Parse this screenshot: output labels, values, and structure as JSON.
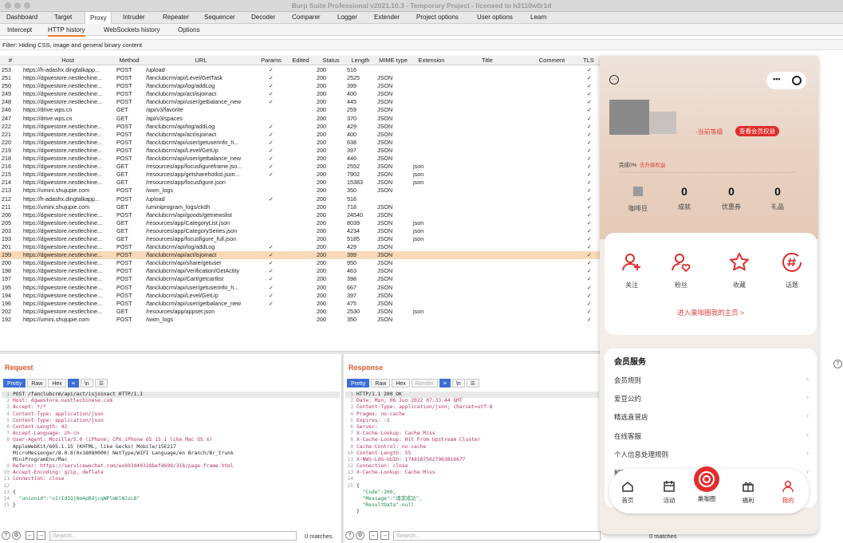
{
  "window": {
    "title": "Burp Suite Professional v2021.10.3 - Temporary Project - licensed to h3110w0r1d"
  },
  "menu": [
    "Dashboard",
    "Target",
    "Proxy",
    "Intruder",
    "Repeater",
    "Sequencer",
    "Decoder",
    "Comparer",
    "Logger",
    "Extender",
    "Project options",
    "User options",
    "Learn"
  ],
  "subtabs": [
    "Intercept",
    "HTTP history",
    "WebSockets history",
    "Options"
  ],
  "filter": "Filter: Hiding CSS, image and general binary content",
  "columns": [
    "#",
    "Host",
    "Method",
    "URL",
    "Params",
    "Edited",
    "Status",
    "Length",
    "MIME type",
    "Extension",
    "Title",
    "Comment",
    "TLS"
  ],
  "rows": [
    {
      "n": "253",
      "host": "https://h-adashx.dingtalkapp...",
      "m": "POST",
      "url": "/upload",
      "p": "✓",
      "st": "200",
      "len": "516",
      "mime": "",
      "ext": "",
      "tls": "✓"
    },
    {
      "n": "251",
      "host": "https://dgwestore.nestlechine...",
      "m": "POST",
      "url": "/fanclubcrm/api/Level/GetTask",
      "p": "✓",
      "st": "200",
      "len": "2525",
      "mime": "JSON",
      "ext": "",
      "tls": "✓"
    },
    {
      "n": "250",
      "host": "https://dgwestore.nestlechine...",
      "m": "POST",
      "url": "/fanclubcrm/api/log/addLog",
      "p": "✓",
      "st": "200",
      "len": "399",
      "mime": "JSON",
      "ext": "",
      "tls": "✓"
    },
    {
      "n": "249",
      "host": "https://dgwestore.nestlechine...",
      "m": "POST",
      "url": "/fanclubcrm/api/act/isjoinact",
      "p": "✓",
      "st": "200",
      "len": "400",
      "mime": "JSON",
      "ext": "",
      "tls": "✓"
    },
    {
      "n": "248",
      "host": "https://dgwestore.nestlechine...",
      "m": "POST",
      "url": "/fanclubcrm/api/user/getbalance_new",
      "p": "✓",
      "st": "200",
      "len": "445",
      "mime": "JSON",
      "ext": "",
      "tls": "✓"
    },
    {
      "n": "246",
      "host": "https://drive.wps.cn",
      "m": "GET",
      "url": "/api/v3/favorite",
      "p": "",
      "st": "200",
      "len": "259",
      "mime": "JSON",
      "ext": "",
      "tls": "✓"
    },
    {
      "n": "247",
      "host": "https://drive.wps.cn",
      "m": "GET",
      "url": "/api/v3/spaces",
      "p": "",
      "st": "200",
      "len": "370",
      "mime": "JSON",
      "ext": "",
      "tls": "✓"
    },
    {
      "n": "222",
      "host": "https://dgwestore.nestlechine...",
      "m": "POST",
      "url": "/fanclubcrm/api/log/addLog",
      "p": "✓",
      "st": "200",
      "len": "429",
      "mime": "JSON",
      "ext": "",
      "tls": "✓"
    },
    {
      "n": "221",
      "host": "https://dgwestore.nestlechine...",
      "m": "POST",
      "url": "/fanclubcrm/api/act/isjoinact",
      "p": "✓",
      "st": "200",
      "len": "400",
      "mime": "JSON",
      "ext": "",
      "tls": "✓"
    },
    {
      "n": "220",
      "host": "https://dgwestore.nestlechine...",
      "m": "POST",
      "url": "/fanclubcrm/api/user/getuserinfo_h...",
      "p": "✓",
      "st": "200",
      "len": "638",
      "mime": "JSON",
      "ext": "",
      "tls": "✓"
    },
    {
      "n": "219",
      "host": "https://dgwestore.nestlechine...",
      "m": "POST",
      "url": "/fanclubcrm/api/Level/GetUp",
      "p": "✓",
      "st": "200",
      "len": "397",
      "mime": "JSON",
      "ext": "",
      "tls": "✓"
    },
    {
      "n": "218",
      "host": "https://dgwestore.nestlechine...",
      "m": "POST",
      "url": "/fanclubcrm/api/user/getbalance_new",
      "p": "✓",
      "st": "200",
      "len": "446",
      "mime": "JSON",
      "ext": "",
      "tls": "✓"
    },
    {
      "n": "216",
      "host": "https://dgwestore.nestlechine...",
      "m": "GET",
      "url": "/resources/app/focusfigureframe.jso...",
      "p": "✓",
      "st": "200",
      "len": "2552",
      "mime": "JSON",
      "ext": "json",
      "tls": "✓"
    },
    {
      "n": "215",
      "host": "https://dgwestore.nestlechine...",
      "m": "GET",
      "url": "/resources/app/getsharehotlist.json...",
      "p": "✓",
      "st": "200",
      "len": "7902",
      "mime": "JSON",
      "ext": "json",
      "tls": "✓"
    },
    {
      "n": "214",
      "host": "https://dgwestore.nestlechine...",
      "m": "GET",
      "url": "/resources/app/focusfigure.json",
      "p": "",
      "st": "200",
      "len": "15383",
      "mime": "JSON",
      "ext": "json",
      "tls": "✓"
    },
    {
      "n": "213",
      "host": "https://umini.shujupie.com",
      "m": "POST",
      "url": "/wxm_logs",
      "p": "",
      "st": "200",
      "len": "350",
      "mime": "JSON",
      "ext": "",
      "tls": "✓"
    },
    {
      "n": "212",
      "host": "https://h-adashx.dingtalkapp...",
      "m": "POST",
      "url": "/upload",
      "p": "✓",
      "st": "200",
      "len": "516",
      "mime": "",
      "ext": "",
      "tls": "✓"
    },
    {
      "n": "211",
      "host": "https://umini.shujupie.com",
      "m": "GET",
      "url": "/uminiprogram_logs/ckdh",
      "p": "",
      "st": "200",
      "len": "718",
      "mime": "JSON",
      "ext": "",
      "tls": "✓"
    },
    {
      "n": "206",
      "host": "https://dgwestore.nestlechine...",
      "m": "POST",
      "url": "/fanclubcrm/api/goods/getnewslist",
      "p": "",
      "st": "200",
      "len": "24540",
      "mime": "JSON",
      "ext": "",
      "tls": "✓"
    },
    {
      "n": "205",
      "host": "https://dgwestore.nestlechine...",
      "m": "GET",
      "url": "/resources/app/CategoryList.json",
      "p": "",
      "st": "200",
      "len": "8039",
      "mime": "JSON",
      "ext": "json",
      "tls": "✓"
    },
    {
      "n": "203",
      "host": "https://dgwestore.nestlechine...",
      "m": "GET",
      "url": "/resources/app/CategorySeries.json",
      "p": "",
      "st": "200",
      "len": "4234",
      "mime": "JSON",
      "ext": "json",
      "tls": "✓"
    },
    {
      "n": "193",
      "host": "https://dgwestore.nestlechine...",
      "m": "GET",
      "url": "/resources/app/focusfigure_full.json",
      "p": "",
      "st": "200",
      "len": "5185",
      "mime": "JSON",
      "ext": "json",
      "tls": "✓"
    },
    {
      "n": "201",
      "host": "https://dgwestore.nestlechine...",
      "m": "POST",
      "url": "/fanclubcrm/api/log/addLog",
      "p": "✓",
      "st": "200",
      "len": "429",
      "mime": "JSON",
      "ext": "",
      "tls": "✓"
    },
    {
      "n": "199",
      "host": "https://dgwestore.nestlechine...",
      "m": "POST",
      "url": "/fanclubcrm/api/act/isjoinact",
      "p": "✓",
      "st": "200",
      "len": "399",
      "mime": "JSON",
      "ext": "",
      "tls": "✓",
      "sel": true
    },
    {
      "n": "200",
      "host": "https://dgwestore.nestlechine...",
      "m": "POST",
      "url": "/fanclubcrm/api/share/getuser",
      "p": "✓",
      "st": "200",
      "len": "950",
      "mime": "JSON",
      "ext": "",
      "tls": "✓"
    },
    {
      "n": "198",
      "host": "https://dgwestore.nestlechine...",
      "m": "POST",
      "url": "/fanclubcrm/api/Verification/GetActity",
      "p": "✓",
      "st": "200",
      "len": "463",
      "mime": "JSON",
      "ext": "",
      "tls": "✓"
    },
    {
      "n": "197",
      "host": "https://dgwestore.nestlechine...",
      "m": "POST",
      "url": "/fanclubcrm/api/Cart/getcartlist",
      "p": "✓",
      "st": "200",
      "len": "398",
      "mime": "JSON",
      "ext": "",
      "tls": "✓"
    },
    {
      "n": "195",
      "host": "https://dgwestore.nestlechine...",
      "m": "POST",
      "url": "/fanclubcrm/api/user/getuserinfo_h...",
      "p": "✓",
      "st": "200",
      "len": "667",
      "mime": "JSON",
      "ext": "",
      "tls": "✓"
    },
    {
      "n": "194",
      "host": "https://dgwestore.nestlechine...",
      "m": "POST",
      "url": "/fanclubcrm/api/Level/GetUp",
      "p": "✓",
      "st": "200",
      "len": "397",
      "mime": "JSON",
      "ext": "",
      "tls": "✓"
    },
    {
      "n": "196",
      "host": "https://dgwestore.nestlechine...",
      "m": "POST",
      "url": "/fanclubcrm/api/user/getbalance_new",
      "p": "✓",
      "st": "200",
      "len": "475",
      "mime": "JSON",
      "ext": "",
      "tls": "✓"
    },
    {
      "n": "202",
      "host": "https://dgwestore.nestlechine...",
      "m": "GET",
      "url": "/resources/app/appset.json",
      "p": "",
      "st": "200",
      "len": "2530",
      "mime": "JSON",
      "ext": "json",
      "tls": "✓"
    },
    {
      "n": "192",
      "host": "https://umini.shujupie.com",
      "m": "POST",
      "url": "/wxm_logs",
      "p": "",
      "st": "200",
      "len": "350",
      "mime": "JSON",
      "ext": "",
      "tls": "✓"
    }
  ],
  "request": {
    "heading": "Request",
    "buttons": [
      "Pretty",
      "Raw",
      "Hex",
      "≡",
      "\\n",
      "☰"
    ],
    "lines": [
      "POST /fanclubcrm/api/act/isjoinact HTTP/1.1",
      "Host: dgwestore.nestlechinese.com",
      "Accept: */*",
      "Content-Type: application/json",
      "Content-Type: application/json",
      "Content-Length: 42",
      "Accept-Language: zh-cn",
      "User-Agent: Mozilla/5.0 (iPhone; CPU iPhone OS 15_1 like Mac OS X)",
      "AppleWebKit/605.1.15 (KHTML, like Gecko) Mobile/15E217",
      "MicroMessenger/8.0.8(0x18080000) NetType/WIFI Language/en Branch/Br_trunk",
      "MiniProgramEnv/Mac",
      "Referer: https://servicewechat.com/wx693d49328befd699/318/page-frame.html",
      "Accept-Encoding: gzip, deflate",
      "Connection: close",
      "",
      "{",
      "  \"unionid\":\"oIrIdIQj6m4pRdjcqWPlmKlNJzL8\"",
      "}"
    ],
    "line_numbers": [
      "1",
      "2",
      "3",
      "4",
      "5",
      "6",
      "7",
      "8",
      "",
      "",
      "",
      "9",
      "10",
      "11",
      "12",
      "13",
      "14",
      "15"
    ],
    "search_placeholder": "Search...",
    "matches": "0 matches"
  },
  "response": {
    "heading": "Response",
    "buttons": [
      "Pretty",
      "Raw",
      "Hex",
      "Render",
      "≡",
      "\\n",
      "☰"
    ],
    "lines": [
      "HTTP/1.1 200 OK",
      "Date: Mon, 06 Jun 2022 07:33:44 GMT",
      "Content-Type: application/json; charset=utf-8",
      "Pragma: no-cache",
      "Expires: -1",
      "Server:",
      "X-Cache-Lookup: Cache Miss",
      "X-Cache-Lookup: Hit From Upstream Cluster",
      "Cache-Control: no-cache",
      "Content-Length: 55",
      "X-NWS-LOG-UUID: 17481875027963816677",
      "Connection: close",
      "X-Cache-Lookup: Cache Miss",
      "",
      "{",
      "  \"Code\":200,",
      "  \"Message\":\"请求成功\",",
      "  \"ResultData\":null",
      "}"
    ],
    "line_numbers": [
      "1",
      "2",
      "3",
      "4",
      "5",
      "6",
      "7",
      "8",
      "9",
      "10",
      "11",
      "12",
      "13",
      "14",
      "15",
      "",
      "",
      "",
      ""
    ],
    "search_placeholder": "Search...",
    "matches": "0 matches"
  },
  "mini": {
    "level_text": "-当前等级",
    "vip_btn": "查看会员权益",
    "progress_label": "完成0%",
    "progress_link": "去升级权益",
    "stats": [
      {
        "v": "",
        "l": "咖啡豆"
      },
      {
        "v": "0",
        "l": "成就"
      },
      {
        "v": "0",
        "l": "优惠券"
      },
      {
        "v": "0",
        "l": "礼品"
      }
    ],
    "icons": [
      {
        "l": "关注",
        "icon": "person-add-icon"
      },
      {
        "l": "粉丝",
        "icon": "person-heart-icon"
      },
      {
        "l": "收藏",
        "icon": "star-icon"
      },
      {
        "l": "话题",
        "icon": "hashtag-icon"
      }
    ],
    "homepage_link": "进入巢咖圈我的主页 >",
    "service_heading": "会员服务",
    "services": [
      "会员规则",
      "爱豆公约",
      "精选直营店",
      "在线客服",
      "个人信息处理规则",
      "解除绑定"
    ],
    "tabs": [
      "首页",
      "活动",
      "巢咖圈",
      "福利",
      "我的"
    ],
    "accent": "#e02c2c"
  }
}
